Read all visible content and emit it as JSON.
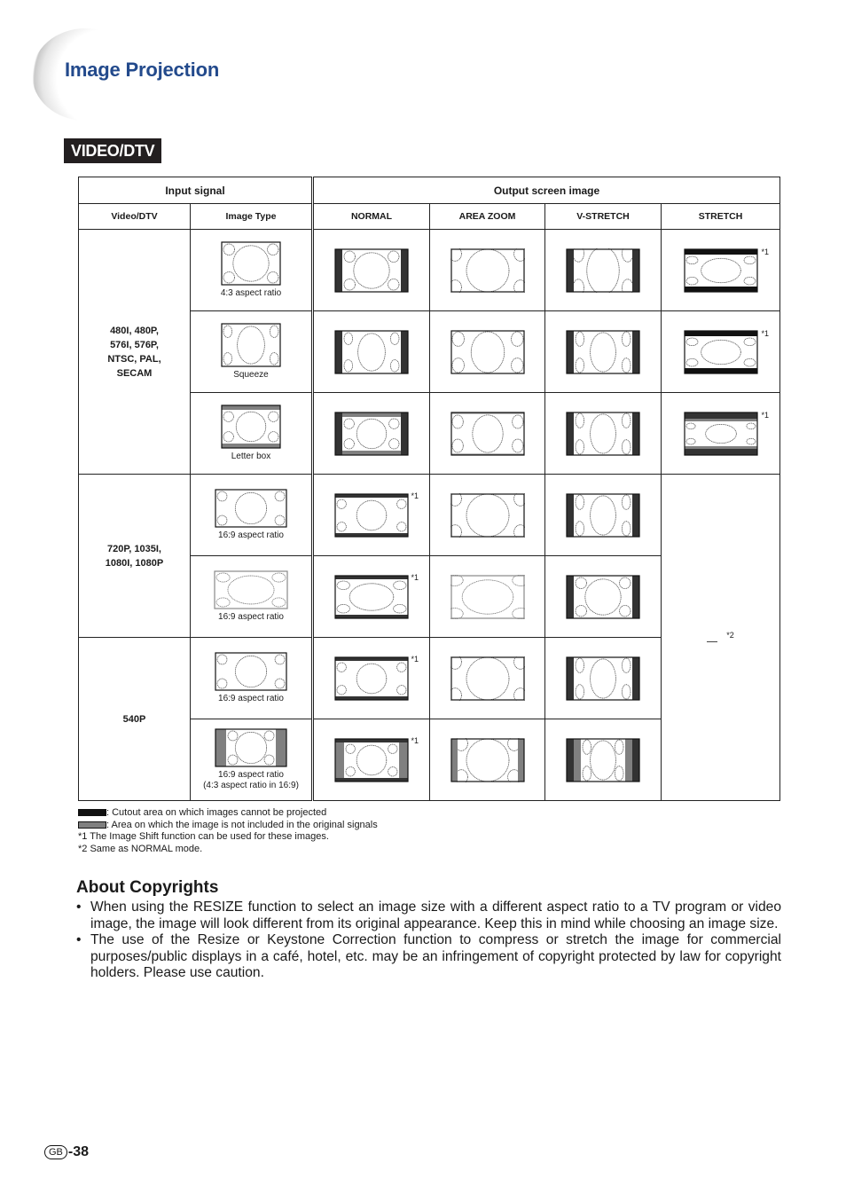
{
  "header": {
    "title": "Image Projection",
    "section_badge": "VIDEO/DTV"
  },
  "colors": {
    "title": "#234a8c",
    "cutout": "#333333",
    "not_in_signal": "#808080",
    "badge_bg": "#231f20"
  },
  "table": {
    "group_headers": {
      "input": "Input signal",
      "output": "Output screen image"
    },
    "columns": [
      "Video/DTV",
      "Image Type",
      "NORMAL",
      "AREA ZOOM",
      "V-STRETCH",
      "STRETCH"
    ],
    "groups": [
      {
        "signal": "480I, 480P, 576I, 576P, NTSC, PAL, SECAM",
        "rows": [
          {
            "image_type": "4:3 aspect ratio",
            "input": {
              "w": 66,
              "h": 48,
              "shape": "43"
            },
            "normal": {
              "w": 82,
              "h": 48,
              "side": "cut",
              "shape": "43"
            },
            "area_zoom": {
              "w": 82,
              "h": 48,
              "shape": "43zoom"
            },
            "v_stretch": {
              "w": 82,
              "h": 48,
              "side": "cut",
              "shape": "43vs"
            },
            "stretch": {
              "w": 82,
              "h": 48,
              "tb": "cut",
              "shape": "43st"
            },
            "notes": {
              "normal": "",
              "area_zoom": "",
              "v_stretch": "",
              "stretch": "*1"
            }
          },
          {
            "image_type": "Squeeze",
            "input": {
              "w": 66,
              "h": 48,
              "shape": "sq"
            },
            "normal": {
              "w": 82,
              "h": 48,
              "side": "cut",
              "shape": "sq"
            },
            "area_zoom": {
              "w": 82,
              "h": 48,
              "shape": "sqzoom"
            },
            "v_stretch": {
              "w": 82,
              "h": 48,
              "side": "cut",
              "shape": "sqvs"
            },
            "stretch": {
              "w": 82,
              "h": 48,
              "tb": "cut",
              "shape": "sqst"
            },
            "notes": {
              "normal": "",
              "area_zoom": "",
              "v_stretch": "",
              "stretch": "*1"
            }
          },
          {
            "image_type": "Letter box",
            "input": {
              "w": 66,
              "h": 48,
              "tb": "gray",
              "shape": "lb"
            },
            "normal": {
              "w": 82,
              "h": 48,
              "side": "cut",
              "tb": "gray",
              "shape": "lb"
            },
            "area_zoom": {
              "w": 82,
              "h": 48,
              "tbthin": "gray",
              "shape": "lbzoom"
            },
            "v_stretch": {
              "w": 82,
              "h": 48,
              "side": "cut",
              "shape": "lbvs"
            },
            "stretch": {
              "w": 82,
              "h": 48,
              "tb": "cutgray",
              "shape": "lbst"
            },
            "notes": {
              "normal": "",
              "area_zoom": "",
              "v_stretch": "",
              "stretch": "*1"
            }
          }
        ]
      },
      {
        "signal": "720P, 1035I, 1080I, 1080P",
        "rows": [
          {
            "image_type": "16:9 aspect ratio",
            "input": {
              "w": 80,
              "h": 42,
              "shape": "169"
            },
            "normal": {
              "w": 82,
              "h": 48,
              "tbthick": "cut",
              "shape": "169"
            },
            "area_zoom": {
              "w": 82,
              "h": 48,
              "shape": "169zoom"
            },
            "v_stretch": {
              "w": 82,
              "h": 48,
              "side": "cut",
              "shape": "169vs"
            },
            "notes": {
              "normal": "*1",
              "area_zoom": "",
              "v_stretch": ""
            }
          },
          {
            "image_type": "16:9 aspect ratio",
            "input": {
              "w": 82,
              "h": 42,
              "shape": "169wide",
              "gray": true
            },
            "normal": {
              "w": 82,
              "h": 48,
              "tbthick": "cut",
              "shape": "169wide"
            },
            "area_zoom": {
              "w": 82,
              "h": 48,
              "shape": "169widezoom",
              "gray": true
            },
            "v_stretch": {
              "w": 82,
              "h": 48,
              "side": "cut",
              "shape": "169"
            },
            "notes": {
              "normal": "*1",
              "area_zoom": "",
              "v_stretch": ""
            }
          }
        ],
        "stretch_note": "*2"
      },
      {
        "signal": "540P",
        "rows": [
          {
            "image_type": "16:9 aspect ratio",
            "input": {
              "w": 80,
              "h": 42,
              "shape": "169"
            },
            "normal": {
              "w": 82,
              "h": 48,
              "tbthick": "cut",
              "shape": "169"
            },
            "area_zoom": {
              "w": 82,
              "h": 48,
              "shape": "169zoom"
            },
            "v_stretch": {
              "w": 82,
              "h": 48,
              "side": "cut",
              "shape": "169vs"
            },
            "notes": {
              "normal": "*1",
              "area_zoom": "",
              "v_stretch": ""
            }
          },
          {
            "image_type": "16:9 aspect ratio",
            "image_type_extra": "(4:3 aspect ratio in 16:9)",
            "input": {
              "w": 80,
              "h": 42,
              "side": "gray",
              "shape": "pill"
            },
            "normal": {
              "w": 82,
              "h": 48,
              "tbthick": "cut",
              "side": "gray",
              "shape": "pill"
            },
            "area_zoom": {
              "w": 82,
              "h": 48,
              "side": "grayin",
              "shape": "pillzoom"
            },
            "v_stretch": {
              "w": 82,
              "h": 48,
              "side": "cutgray",
              "shape": "pillvs"
            },
            "notes": {
              "normal": "*1",
              "area_zoom": "",
              "v_stretch": ""
            }
          }
        ]
      }
    ]
  },
  "legend": {
    "cutout": ": Cutout area on which images cannot be projected",
    "not_in_signal": ": Area on which the image is not included in the original signals",
    "note1": "*1 The Image Shift function can be used for these images.",
    "note2": "*2 Same as NORMAL mode."
  },
  "about": {
    "title": "About Copyrights",
    "bullets": [
      "When using the RESIZE function to select an image size with a different aspect ratio to a TV program or video image, the image will look different from its original appearance. Keep this in mind while choosing an image size.",
      "The use of the Resize or Keystone Correction function to compress or stretch the image for commercial purposes/public displays in a café, hotel, etc. may be an infringement of copyright protected by law for copyright holders. Please use caution."
    ]
  },
  "footer": {
    "region_badge": "GB",
    "page_number": "-38"
  }
}
